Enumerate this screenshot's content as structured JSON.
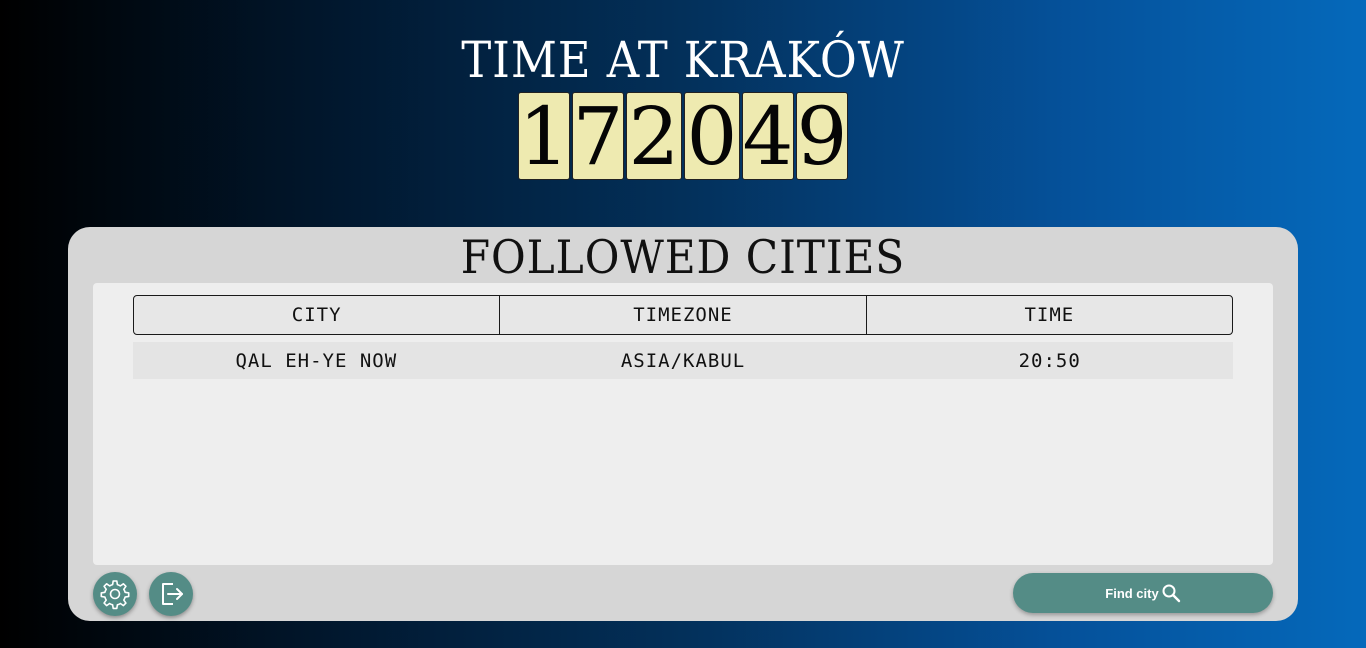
{
  "header": {
    "title": "TIME AT KRAKÓW",
    "clock_digits": [
      "1",
      "7",
      "2",
      "0",
      "4",
      "9"
    ]
  },
  "panel": {
    "title": "FOLLOWED CITIES",
    "columns": [
      "CITY",
      "TIMEZONE",
      "TIME"
    ],
    "rows": [
      {
        "city": "QAL EH-YE NOW",
        "timezone": "ASIA/KABUL",
        "time": "20:50"
      }
    ]
  },
  "footer": {
    "settings_icon": "gear-icon",
    "logout_icon": "logout-icon",
    "find_city_label": "Find city",
    "find_city_icon": "search-icon"
  },
  "colors": {
    "accent": "#548c86",
    "digit_bg": "#eeeab0",
    "panel_bg": "#d6d6d6"
  }
}
